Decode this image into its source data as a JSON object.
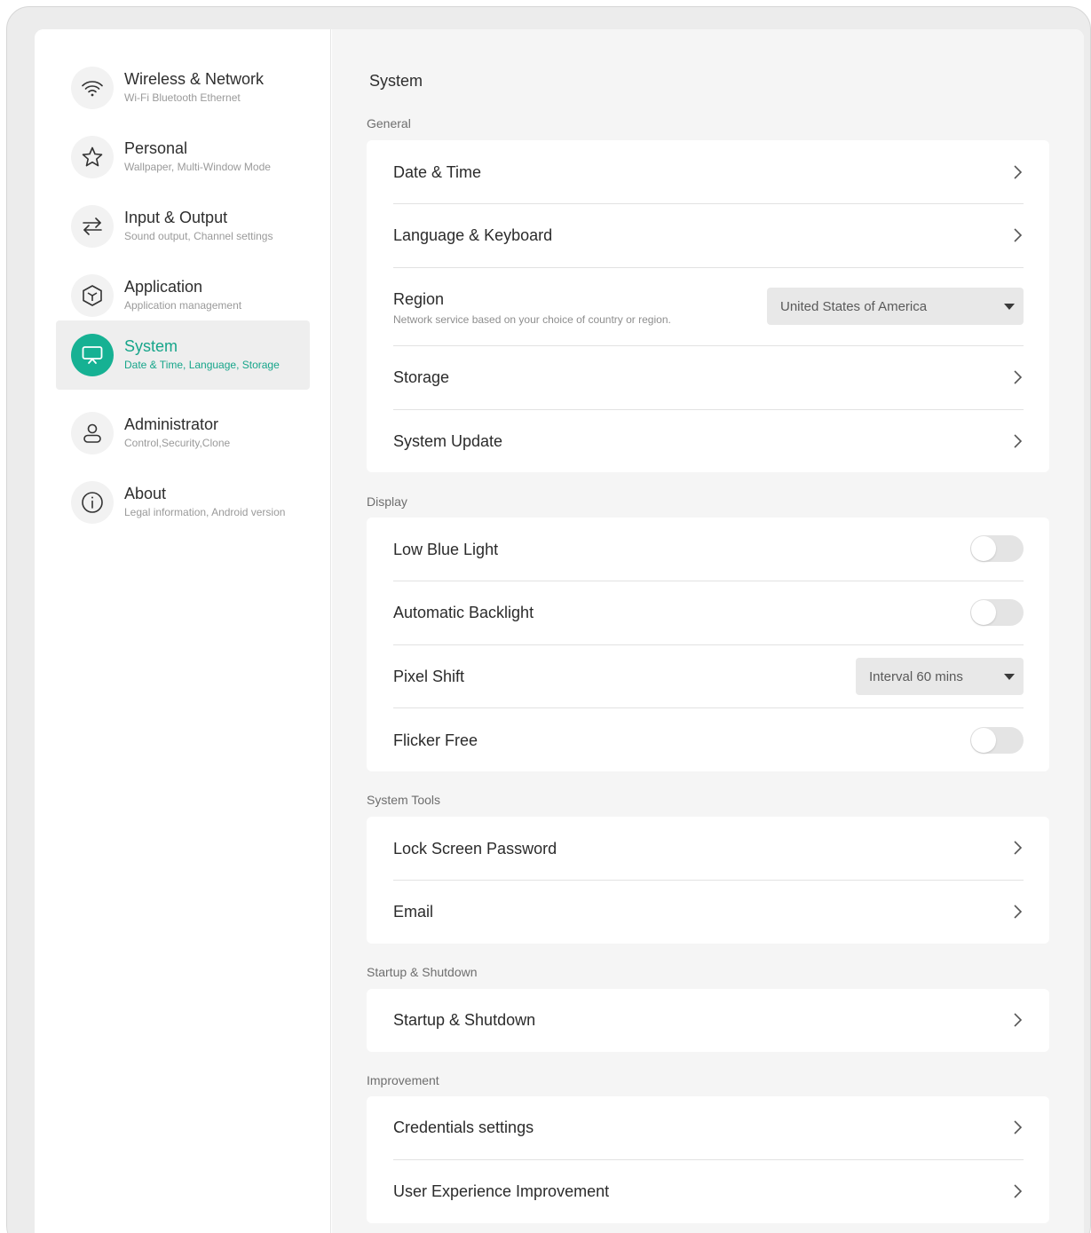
{
  "sidebar": {
    "items": [
      {
        "title": "Wireless & Network",
        "subtitle": "Wi-Fi Bluetooth Ethernet",
        "icon": "wifi-icon"
      },
      {
        "title": "Personal",
        "subtitle": "Wallpaper, Multi-Window Mode",
        "icon": "star-icon"
      },
      {
        "title": "Input & Output",
        "subtitle": "Sound output, Channel settings",
        "icon": "swap-arrows-icon"
      },
      {
        "title": "Application",
        "subtitle": "Application management",
        "icon": "cube-icon"
      },
      {
        "title": "System",
        "subtitle": "Date & Time, Language, Storage",
        "icon": "presentation-board-icon",
        "active": true
      },
      {
        "title": "Administrator",
        "subtitle": "Control,Security,Clone",
        "icon": "user-icon"
      },
      {
        "title": "About",
        "subtitle": "Legal information, Android version",
        "icon": "info-icon"
      }
    ]
  },
  "main": {
    "title": "System",
    "sections": {
      "general": {
        "label": "General",
        "date_time": "Date & Time",
        "language_keyboard": "Language & Keyboard",
        "region": "Region",
        "region_sub": "Network service based on your choice of country or region.",
        "region_value": "United States of America",
        "storage": "Storage",
        "system_update": "System Update"
      },
      "display": {
        "label": "Display",
        "low_blue_light": "Low Blue Light",
        "low_blue_light_on": false,
        "automatic_backlight": "Automatic Backlight",
        "automatic_backlight_on": false,
        "pixel_shift": "Pixel Shift",
        "pixel_shift_value": "Interval 60 mins",
        "flicker_free": "Flicker Free",
        "flicker_free_on": false
      },
      "system_tools": {
        "label": "System Tools",
        "lock_screen_password": "Lock Screen Password",
        "email": "Email"
      },
      "startup_shutdown": {
        "label": "Startup & Shutdown",
        "startup_shutdown": "Startup & Shutdown"
      },
      "improvement": {
        "label": "Improvement",
        "credentials_settings": "Credentials settings",
        "user_experience_improvement": "User Experience Improvement"
      }
    }
  },
  "colors": {
    "accent": "#16b193",
    "active_text": "#16a58a",
    "panel_bg": "#f5f5f5",
    "toggle_off": "#e4e4e4"
  }
}
